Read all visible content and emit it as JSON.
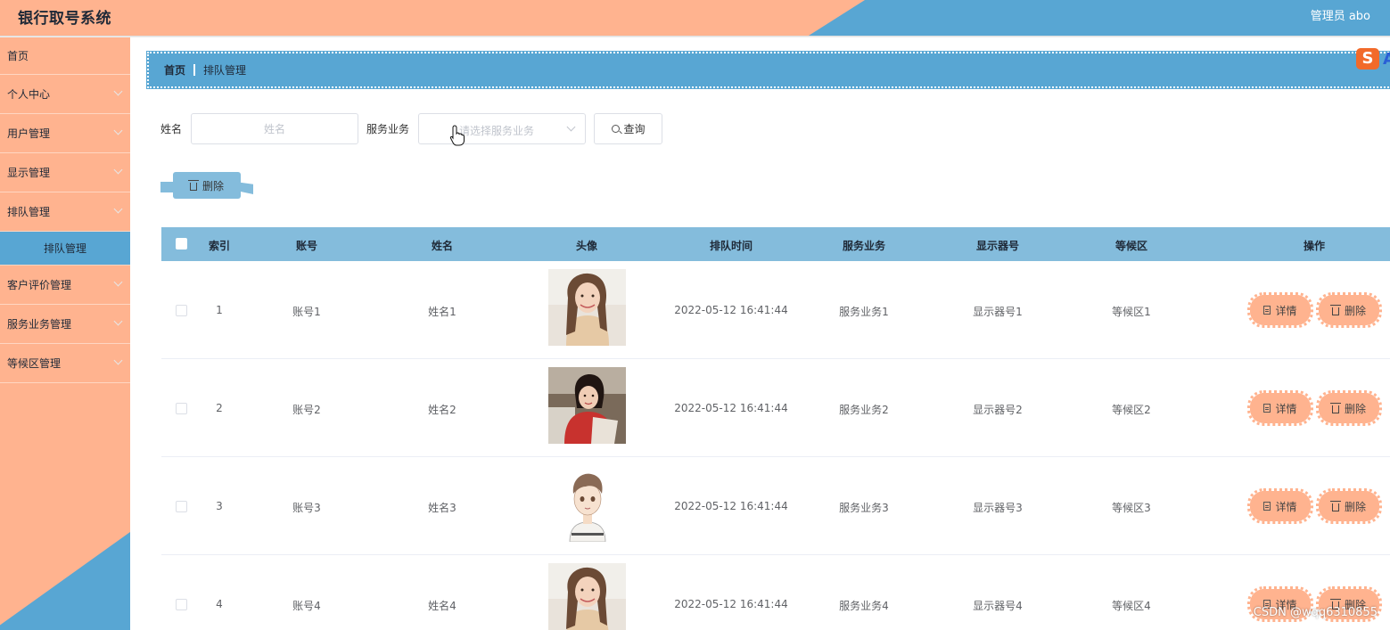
{
  "app": {
    "title": "银行取号系统",
    "user": "管理员 abo"
  },
  "sidebar": {
    "items": [
      {
        "label": "首页"
      },
      {
        "label": "个人中心"
      },
      {
        "label": "用户管理"
      },
      {
        "label": "显示管理"
      },
      {
        "label": "排队管理"
      },
      {
        "label": "排队管理"
      },
      {
        "label": "客户评价管理"
      },
      {
        "label": "服务业务管理"
      },
      {
        "label": "等候区管理"
      }
    ]
  },
  "breadcrumb": {
    "home": "首页",
    "current": "排队管理"
  },
  "search": {
    "name_label": "姓名",
    "name_placeholder": "姓名",
    "service_label": "服务业务",
    "service_placeholder": "请选择服务业务",
    "query_label": "查询"
  },
  "toolbar": {
    "delete_label": "删除"
  },
  "table": {
    "headers": [
      "索引",
      "账号",
      "姓名",
      "头像",
      "排队时间",
      "服务业务",
      "显示器号",
      "等候区",
      "操作"
    ],
    "rows": [
      {
        "index": "1",
        "account": "账号1",
        "name": "姓名1",
        "time": "2022-05-12 16:41:44",
        "service": "服务业务1",
        "display": "显示器号1",
        "area": "等候区1"
      },
      {
        "index": "2",
        "account": "账号2",
        "name": "姓名2",
        "time": "2022-05-12 16:41:44",
        "service": "服务业务2",
        "display": "显示器号2",
        "area": "等候区2"
      },
      {
        "index": "3",
        "account": "账号3",
        "name": "姓名3",
        "time": "2022-05-12 16:41:44",
        "service": "服务业务3",
        "display": "显示器号3",
        "area": "等候区3"
      },
      {
        "index": "4",
        "account": "账号4",
        "name": "姓名4",
        "time": "2022-05-12 16:41:44",
        "service": "服务业务4",
        "display": "显示器号4",
        "area": "等候区4"
      }
    ],
    "detail_label": "详情",
    "delete_label": "删除"
  },
  "watermark": "CSDN @wqq6310855",
  "colors": {
    "peach": "#ffb38f",
    "blue": "#58a6d3",
    "light_blue": "#84bcdc"
  },
  "icons": [
    "search-icon",
    "trash-icon",
    "document-icon",
    "chevron-down-icon",
    "sogou-icon"
  ]
}
